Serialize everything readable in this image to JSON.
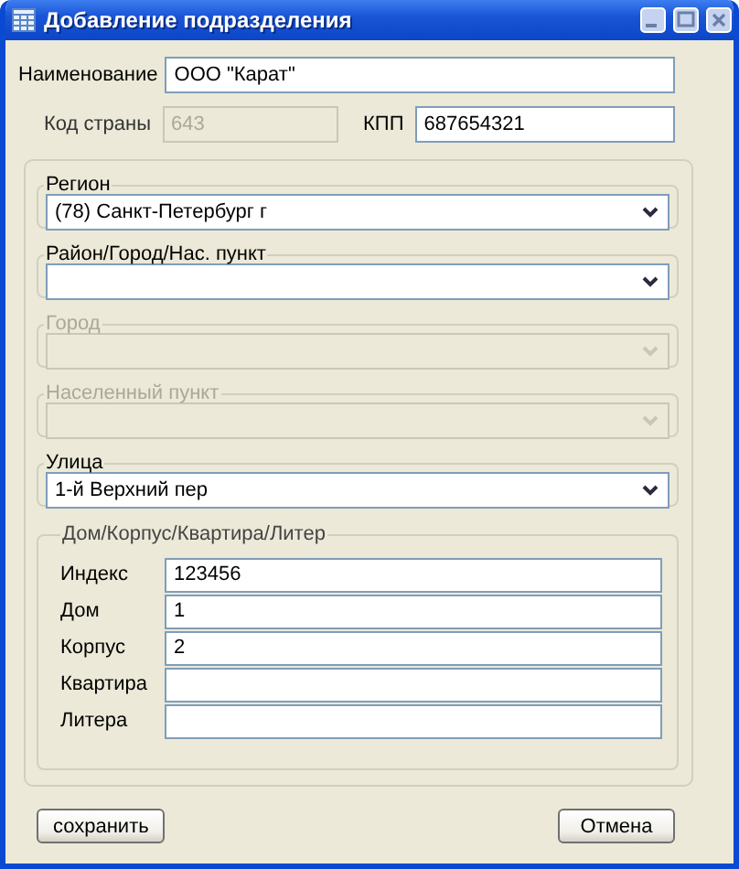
{
  "window": {
    "title": "Добавление подразделения"
  },
  "name_field": {
    "label": "Наименование",
    "value": "ООО \"Карат\""
  },
  "country_code": {
    "label": "Код страны",
    "value": "643",
    "disabled": true
  },
  "kpp": {
    "label": "КПП",
    "value": "687654321",
    "disabled": false
  },
  "address_groups": [
    {
      "legend": "Регион",
      "value": "(78) Санкт-Петербург г",
      "disabled": false
    },
    {
      "legend": "Район/Город/Нас. пункт",
      "disabled": false
    },
    {
      "legend": "Город",
      "disabled": true
    },
    {
      "legend": "Населенный пункт",
      "disabled": true
    },
    {
      "legend": "Улица",
      "value": "1-й Верхний пер",
      "disabled": false
    }
  ],
  "house_group": {
    "legend": "Дом/Корпус/Квартира/Литер",
    "fields": [
      {
        "label": "Индекс",
        "value": "123456"
      },
      {
        "label": "Дом",
        "value": "1"
      },
      {
        "label": "Корпус",
        "value": "2"
      },
      {
        "label": "Квартира"
      },
      {
        "label": "Литера"
      }
    ]
  },
  "buttons": [
    {
      "label": "сохранить",
      "kind": "save"
    },
    {
      "label": "Отмена",
      "kind": "cancel"
    }
  ]
}
